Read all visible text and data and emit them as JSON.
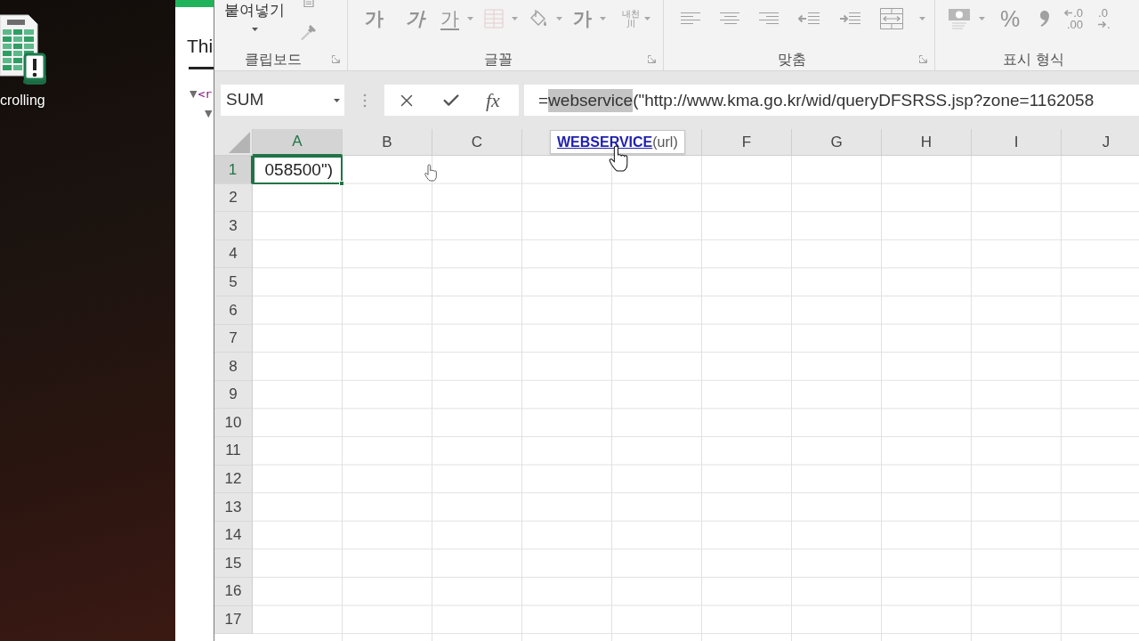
{
  "desktop": {
    "icons": [
      {
        "label": "crolling"
      }
    ]
  },
  "browser": {
    "heading": "Thi",
    "tree": [
      {
        "toggle": "▼",
        "tag": "<r",
        "children": [
          {
            "toggle": "▼"
          }
        ]
      }
    ]
  },
  "ribbon": {
    "disabled": true,
    "groups": [
      {
        "label": "클립보드",
        "launcher": true,
        "items": [
          {
            "kind": "paste",
            "text": "붙여넣기",
            "dropdown": true
          },
          {
            "kind": "copy"
          },
          {
            "kind": "painter"
          }
        ]
      },
      {
        "label": "글꼴",
        "launcher": true,
        "items": [
          {
            "kind": "bold",
            "text": "가"
          },
          {
            "kind": "italic",
            "text": "가"
          },
          {
            "kind": "underline",
            "text": "가",
            "dropdown": true
          },
          {
            "kind": "borders",
            "dropdown": true
          },
          {
            "kind": "fill",
            "dropdown": true
          },
          {
            "kind": "fontcolor",
            "text": "가",
            "dropdown": true
          },
          {
            "kind": "phonetic",
            "text": "내천",
            "sub": "川",
            "dropdown": true
          }
        ]
      },
      {
        "label": "맞춤",
        "launcher": true,
        "items": [
          {
            "kind": "alignleft"
          },
          {
            "kind": "aligncenter"
          },
          {
            "kind": "alignright"
          },
          {
            "kind": "outdent"
          },
          {
            "kind": "indent"
          },
          {
            "kind": "merge",
            "dropdown": true
          }
        ]
      },
      {
        "label": "표시 형식",
        "launcher": false,
        "items": [
          {
            "kind": "accounting",
            "dropdown": true
          },
          {
            "kind": "percent",
            "text": "%"
          },
          {
            "kind": "comma"
          },
          {
            "kind": "moredecimals",
            "text": ".0",
            "sub": ".00"
          },
          {
            "kind": "fewerdecimals",
            "text": ".0",
            "sub": "."
          }
        ]
      }
    ]
  },
  "formula_bar": {
    "name_box": "SUM",
    "fx": "fx",
    "formula": [
      {
        "text": "=",
        "selected": false
      },
      {
        "text": "webservice",
        "selected": true
      },
      {
        "text": "(\"http://www.kma.go.kr/wid/queryDFSRSS.jsp?zone=1162058",
        "selected": false
      }
    ]
  },
  "sheet": {
    "columns": [
      {
        "label": "A",
        "selected": true
      },
      {
        "label": "B",
        "selected": false
      },
      {
        "label": "C",
        "selected": false
      },
      {
        "selected": false
      },
      {
        "selected": false
      },
      {
        "label": "F",
        "selected": false
      },
      {
        "label": "G",
        "selected": false
      },
      {
        "label": "H",
        "selected": false
      },
      {
        "label": "I",
        "selected": false
      },
      {
        "label": "J",
        "selected": false
      }
    ],
    "rows": [
      {
        "label": "1",
        "selected": true,
        "cells": [
          "058500\")"
        ]
      },
      {
        "label": "2",
        "selected": false
      },
      {
        "label": "3",
        "selected": false
      },
      {
        "label": "4",
        "selected": false
      },
      {
        "label": "5",
        "selected": false
      },
      {
        "label": "6",
        "selected": false
      },
      {
        "label": "7",
        "selected": false
      },
      {
        "label": "8",
        "selected": false
      },
      {
        "label": "9",
        "selected": false
      },
      {
        "label": "10",
        "selected": false
      },
      {
        "label": "11",
        "selected": false
      },
      {
        "label": "12",
        "selected": false
      },
      {
        "label": "13",
        "selected": false
      },
      {
        "label": "14",
        "selected": false
      },
      {
        "label": "15",
        "selected": false
      },
      {
        "label": "16",
        "selected": false
      },
      {
        "label": "17",
        "selected": false
      }
    ],
    "tooltip": {
      "function": "WEBSERVICE",
      "args": "(url)"
    }
  }
}
